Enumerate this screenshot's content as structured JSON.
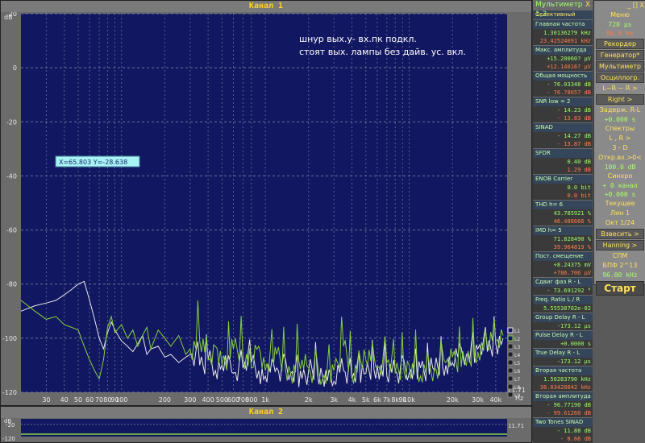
{
  "spectrum": {
    "title": "Канал 1",
    "db_unit": "dB",
    "hz_unit": "Hz",
    "note_line1": "шнур вых.у- вх.пк подкл.",
    "note_line2": "стоят вых. лампы без дайв. ус.  вкл.",
    "cursor_readout": "X=65.803   Y=-28.638",
    "corner_value": "11.71",
    "legend": [
      "L1",
      "L2",
      "L3",
      "L4",
      "L5",
      "L6",
      "L7",
      "L8",
      "L9"
    ]
  },
  "channel2": {
    "title": "Канал 2",
    "db_unit": "dB",
    "tick_label": "-20",
    "bottom_label": "-120",
    "corner_value": "11.71"
  },
  "meter": {
    "title": "Мультиметр 1,2",
    "close_label": "X",
    "mode": "Селективный",
    "rows": [
      {
        "label": "Главная частота",
        "values": [
          "1.30136279 kHz",
          "23.42524091 kHz"
        ]
      },
      {
        "label": "Макс. амплитуда",
        "values": [
          "+15.20060? µV",
          "+12.14016? µV"
        ]
      },
      {
        "label": "Общая мощность",
        "values": [
          "- 76.03348 dB",
          "- 76.78657 dB"
        ]
      },
      {
        "label": "SNR        low = 2",
        "values": [
          "- 14.23 dB",
          "- 13.83 dB"
        ]
      },
      {
        "label": "SINAD",
        "values": [
          "- 14.27 dB",
          "- 13.87 dB"
        ]
      },
      {
        "label": "SFDR",
        "values": [
          "0.40 dB",
          "1.29 dB"
        ]
      },
      {
        "label": "ENOB   Carrier",
        "values": [
          "0.0 bit",
          "0.0 bit"
        ]
      },
      {
        "label": "THD        h= 6",
        "values": [
          "43.785921 %",
          "46.486666 %"
        ]
      },
      {
        "label": "IMD        h= 5",
        "values": [
          "71.828490 %",
          "39.964819 %"
        ]
      },
      {
        "label": "Пост. смещение",
        "values": [
          "+8.24375 mV",
          "+786.706 µV"
        ]
      },
      {
        "label": "Сдвиг фаз R - L",
        "values": [
          "- 73.691292 °"
        ]
      },
      {
        "label": "Freq. Ratio  L / R",
        "values": [
          "5.55538702e-02"
        ]
      },
      {
        "label": "Group Delay R - L",
        "values": [
          "-173.12 µs"
        ]
      },
      {
        "label": "Pulse Delay R - L",
        "values": [
          "+0.0000 s"
        ]
      },
      {
        "label": "True Delay R - L",
        "values": [
          "-173.12 µs"
        ]
      },
      {
        "label": "Вторая частота",
        "values": [
          "1.50283790 kHz",
          "38.03420842 kHz"
        ]
      },
      {
        "label": "Вторая амплитуда",
        "values": [
          "- 96.77190 dB",
          "- 99.61260 dB"
        ]
      },
      {
        "label": "Two Tones SINAD",
        "values": [
          "- 11.88 dB",
          "- 8.66 dB"
        ]
      }
    ]
  },
  "controls": {
    "top_buttons": "_ [] X",
    "menu": "Меню",
    "buffer_value": "720 µs",
    "buffer_value2": "86.6 ms",
    "items": [
      {
        "type": "btn",
        "text": "Рекордер"
      },
      {
        "type": "btn",
        "text": "Генератор*"
      },
      {
        "type": "btn",
        "text": "Мультиметр"
      },
      {
        "type": "btn",
        "text": "Осциллогр."
      },
      {
        "type": "row",
        "text": "L~R ~ R  >"
      },
      {
        "type": "btn",
        "text": "Right  >"
      },
      {
        "type": "row",
        "text": "Задерж. R-L"
      },
      {
        "type": "val",
        "text": "+0.000 s"
      },
      {
        "type": "row",
        "text": "Спектры"
      },
      {
        "type": "row",
        "text": "L , R    >"
      },
      {
        "type": "row",
        "text": "3 - D"
      },
      {
        "type": "row",
        "text": "Откр.вх.>0<"
      },
      {
        "type": "val",
        "text": "100.0 dB"
      },
      {
        "type": "row",
        "text": "Синхро"
      },
      {
        "type": "val",
        "text": "+ 0 канал"
      },
      {
        "type": "val",
        "text": "+0.000 s"
      },
      {
        "type": "row",
        "text": "Текущее"
      },
      {
        "type": "row",
        "text": "Лин    1"
      },
      {
        "type": "row",
        "text": "Окт  1/24"
      },
      {
        "type": "btn",
        "text": "Взвесить  >"
      },
      {
        "type": "btn",
        "text": "Hanning  >"
      },
      {
        "type": "row",
        "text": "СПМ"
      },
      {
        "type": "row",
        "text": "БПФ  2^13"
      },
      {
        "type": "val",
        "text": "96.00 kHz"
      }
    ],
    "start": "Старт"
  },
  "chart_data": {
    "type": "line",
    "title": "Канал 1",
    "xlabel": "Hz",
    "ylabel": "dB",
    "x_scale": "log",
    "xlim": [
      20,
      48000
    ],
    "ylim": [
      -120,
      20
    ],
    "grid": true,
    "legend_position": "right",
    "x_tick_labels": [
      "30",
      "40",
      "50",
      "60",
      "70",
      "80",
      "90",
      "100",
      "200",
      "300",
      "400",
      "500",
      "600",
      "700",
      "800",
      "1k",
      "2k",
      "3k",
      "4k",
      "5k",
      "6k",
      "7k",
      "8k",
      "9k",
      "10k",
      "20k",
      "30k",
      "40k"
    ],
    "x_tick_values": [
      30,
      40,
      50,
      60,
      70,
      80,
      90,
      100,
      200,
      300,
      400,
      500,
      600,
      700,
      800,
      1000,
      2000,
      3000,
      4000,
      5000,
      6000,
      7000,
      8000,
      9000,
      10000,
      20000,
      30000,
      40000
    ],
    "y_tick_values": [
      20,
      0,
      -20,
      -40,
      -60,
      -80,
      -100,
      -120
    ],
    "series": [
      {
        "color": "#e8e8e8",
        "x": [
          20,
          25,
          30,
          35,
          40,
          45,
          50,
          55,
          60,
          65,
          70,
          75,
          80,
          85,
          90,
          100,
          110,
          120,
          130,
          140,
          150,
          160,
          180,
          200,
          220,
          250,
          280,
          300,
          350,
          400,
          450,
          500,
          600,
          700,
          800,
          900,
          1000,
          1200,
          1500,
          1800,
          2000,
          2500,
          3000,
          3500,
          4000,
          5000,
          6000,
          7000,
          8000,
          10000,
          12000,
          15000,
          18000,
          20000,
          25000,
          30000,
          35000,
          40000,
          45000
        ],
        "y": [
          -90,
          -88,
          -87,
          -86,
          -84,
          -82,
          -80,
          -79,
          -86,
          -93,
          -100,
          -104,
          -98,
          -94,
          -97,
          -101,
          -103,
          -105,
          -102,
          -99,
          -106,
          -104,
          -103,
          -107,
          -106,
          -109,
          -107,
          -106,
          -110,
          -108,
          -112,
          -110,
          -113,
          -111,
          -109,
          -112,
          -114,
          -111,
          -113,
          -115,
          -112,
          -114,
          -116,
          -112,
          -115,
          -113,
          -110,
          -114,
          -112,
          -113,
          -111,
          -112,
          -110,
          -109,
          -106,
          -104,
          -105,
          -102,
          -100
        ]
      },
      {
        "color": "#86d23a",
        "x": [
          20,
          25,
          30,
          35,
          40,
          45,
          50,
          55,
          60,
          65,
          70,
          75,
          80,
          85,
          90,
          100,
          110,
          120,
          130,
          140,
          150,
          160,
          180,
          200,
          220,
          250,
          280,
          300,
          350,
          400,
          450,
          500,
          600,
          700,
          800,
          900,
          1000,
          1200,
          1500,
          1800,
          2000,
          2500,
          3000,
          3500,
          4000,
          5000,
          6000,
          7000,
          8000,
          10000,
          12000,
          15000,
          18000,
          20000,
          25000,
          30000,
          35000,
          40000,
          45000
        ],
        "y": [
          -86,
          -90,
          -93,
          -92,
          -95,
          -96,
          -97,
          -103,
          -108,
          -112,
          -115,
          -108,
          -96,
          -92,
          -98,
          -95,
          -100,
          -97,
          -103,
          -99,
          -96,
          -104,
          -97,
          -100,
          -103,
          -99,
          -106,
          -104,
          -101,
          -108,
          -103,
          -110,
          -104,
          -107,
          -111,
          -103,
          -112,
          -106,
          -113,
          -108,
          -111,
          -115,
          -112,
          -103,
          -114,
          -108,
          -111,
          -109,
          -113,
          -110,
          -114,
          -111,
          -109,
          -107,
          -110,
          -105,
          -103,
          -101,
          -99
        ]
      }
    ]
  }
}
